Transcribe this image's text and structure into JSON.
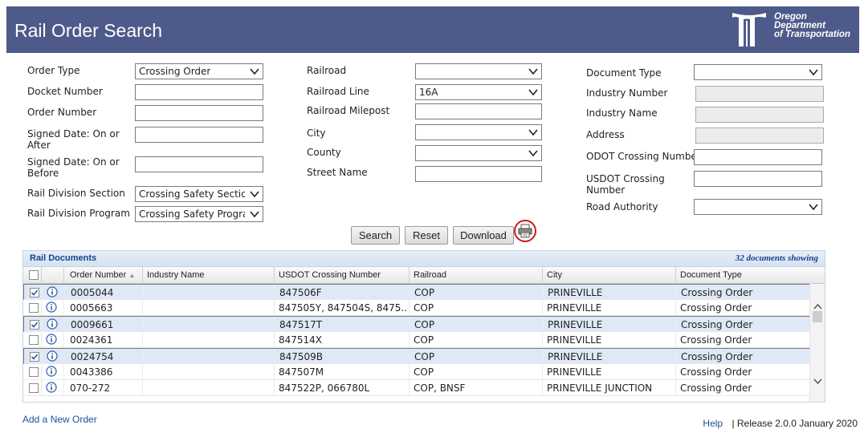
{
  "header": {
    "title": "Rail Order Search",
    "agency_line1": "Oregon",
    "agency_line2": "Department",
    "agency_line3": "of Transportation"
  },
  "form": {
    "order_type": {
      "label": "Order Type",
      "value": "Crossing Order"
    },
    "docket_number": {
      "label": "Docket Number",
      "value": ""
    },
    "order_number": {
      "label": "Order Number",
      "value": ""
    },
    "signed_after": {
      "label_line1": "Signed Date: On or",
      "label_line2": "After",
      "value": ""
    },
    "signed_before": {
      "label_line1": "Signed Date: On or",
      "label_line2": "Before",
      "value": ""
    },
    "rail_division_section": {
      "label": "Rail Division Section",
      "value": "Crossing Safety Section"
    },
    "rail_division_program": {
      "label": "Rail Division Program",
      "value": "Crossing Safety Program"
    },
    "railroad": {
      "label": "Railroad",
      "value": ""
    },
    "railroad_line": {
      "label": "Railroad Line",
      "value": "16A"
    },
    "railroad_milepost": {
      "label": "Railroad Milepost",
      "value": ""
    },
    "city": {
      "label": "City",
      "value": ""
    },
    "county": {
      "label": "County",
      "value": ""
    },
    "street_name": {
      "label": "Street Name",
      "value": ""
    },
    "document_type": {
      "label": "Document Type",
      "value": ""
    },
    "industry_number": {
      "label": "Industry Number",
      "value": ""
    },
    "industry_name": {
      "label": "Industry Name",
      "value": ""
    },
    "address": {
      "label": "Address",
      "value": ""
    },
    "odot_crossing_number": {
      "label": "ODOT Crossing Number",
      "value": ""
    },
    "usdot_crossing_number": {
      "label_line1": "USDOT Crossing",
      "label_line2": "Number",
      "value": ""
    },
    "road_authority": {
      "label": "Road Authority",
      "value": ""
    }
  },
  "buttons": {
    "search": "Search",
    "reset": "Reset",
    "download": "Download",
    "print_icon": "printer-icon"
  },
  "grid": {
    "title": "Rail Documents",
    "count": "32 documents showing",
    "columns": [
      "Order Number",
      "Industry Name",
      "USDOT Crossing Number",
      "Railroad",
      "City",
      "Document Type"
    ],
    "sort_indicator": "▲",
    "rows": [
      {
        "checked": true,
        "order": "0005044",
        "industry": "",
        "usdot": "847506F",
        "railroad": "COP",
        "city": "PRINEVILLE",
        "doc": "Crossing Order"
      },
      {
        "checked": false,
        "order": "0005663",
        "industry": "",
        "usdot": "847505Y, 847504S, 8475...",
        "railroad": "COP",
        "city": "PRINEVILLE",
        "doc": "Crossing Order"
      },
      {
        "checked": true,
        "order": "0009661",
        "industry": "",
        "usdot": "847517T",
        "railroad": "COP",
        "city": "PRINEVILLE",
        "doc": "Crossing Order"
      },
      {
        "checked": false,
        "order": "0024361",
        "industry": "",
        "usdot": "847514X",
        "railroad": "COP",
        "city": "PRINEVILLE",
        "doc": "Crossing Order"
      },
      {
        "checked": true,
        "order": "0024754",
        "industry": "",
        "usdot": "847509B",
        "railroad": "COP",
        "city": "PRINEVILLE",
        "doc": "Crossing Order"
      },
      {
        "checked": false,
        "order": "0043386",
        "industry": "",
        "usdot": "847507M",
        "railroad": "COP",
        "city": "PRINEVILLE",
        "doc": "Crossing Order"
      },
      {
        "checked": false,
        "order": "070-272",
        "industry": "",
        "usdot": "847522P, 066780L",
        "railroad": "COP, BNSF",
        "city": "PRINEVILLE JUNCTION",
        "doc": "Crossing Order"
      }
    ]
  },
  "footer": {
    "add_order": "Add a New Order",
    "help": "Help",
    "release": "| Release 2.0.0 January 2020"
  },
  "colors": {
    "header_bg": "#4d5a8a",
    "link": "#1e4f9c",
    "grid_title": "#15428b",
    "selected_row": "#dfe8f6",
    "print_highlight": "#d01818"
  }
}
